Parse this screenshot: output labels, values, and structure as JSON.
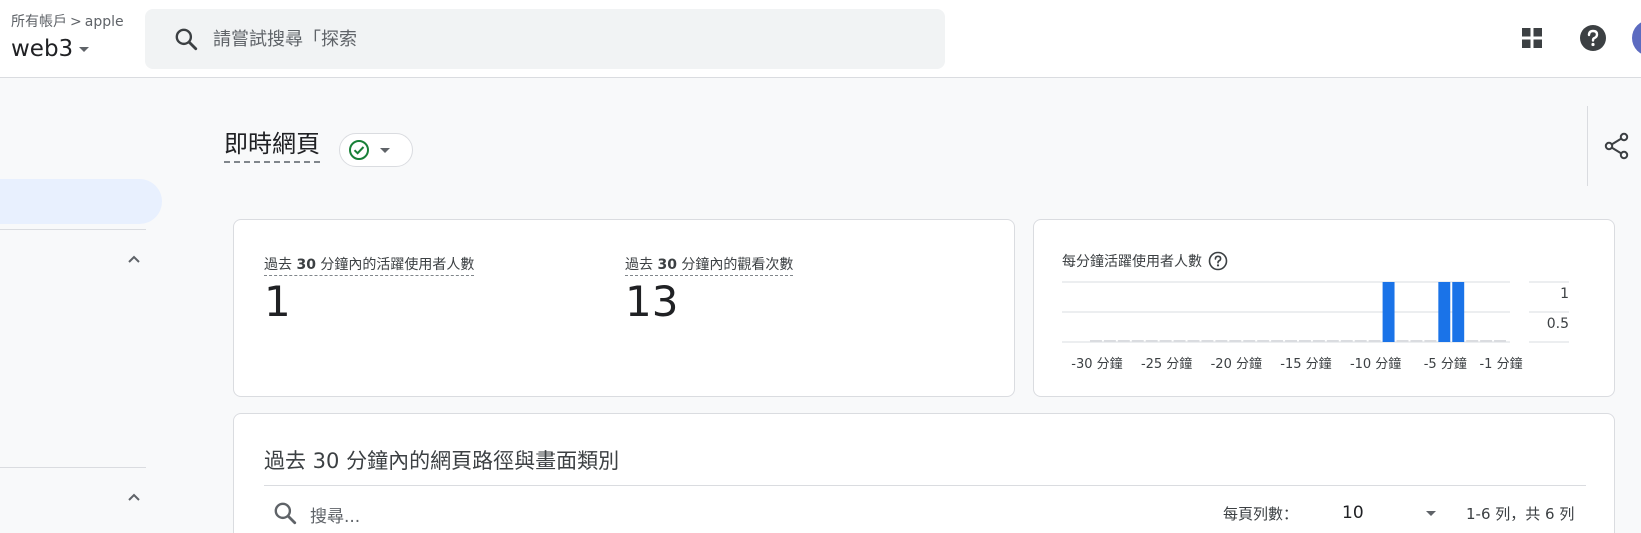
{
  "header": {
    "breadcrumb_root": "所有帳戶",
    "breadcrumb_sep": ">",
    "breadcrumb_account": "apple",
    "property_name": "web3",
    "search_placeholder": "請嘗試搜尋「探索"
  },
  "page": {
    "title": "即時網頁"
  },
  "metrics": [
    {
      "label_prefix": "過去",
      "label_number": "30",
      "label_suffix": "分鐘內的活躍使用者人數",
      "value": "1"
    },
    {
      "label_prefix": "過去",
      "label_number": "30",
      "label_suffix": "分鐘內的觀看次數",
      "value": "13"
    }
  ],
  "chart_title": "每分鐘活躍使用者人數",
  "chart_data": {
    "type": "bar",
    "x": [
      -30,
      -29,
      -28,
      -27,
      -26,
      -25,
      -24,
      -23,
      -22,
      -21,
      -20,
      -19,
      -18,
      -17,
      -16,
      -15,
      -14,
      -13,
      -12,
      -11,
      -10,
      -9,
      -8,
      -7,
      -6,
      -5,
      -4,
      -3,
      -2,
      -1
    ],
    "values": [
      0,
      0,
      0,
      0,
      0,
      0,
      0,
      0,
      0,
      0,
      0,
      0,
      0,
      0,
      0,
      0,
      0,
      0,
      0,
      0,
      0,
      1,
      0,
      0,
      0,
      1,
      1,
      0,
      0,
      0
    ],
    "tick_labels": [
      "-30 分鐘",
      "-25 分鐘",
      "-20 分鐘",
      "-15 分鐘",
      "-10 分鐘",
      "-5 分鐘",
      "-1 分鐘"
    ],
    "tick_values": [
      -30,
      -25,
      -20,
      -15,
      -10,
      -5,
      -1
    ],
    "y_ticks": [
      "1",
      "0.5"
    ],
    "ylim": [
      0,
      1
    ],
    "bar_color": "#1a73e8",
    "zero_color": "#dadce0"
  },
  "table": {
    "title": "過去 30 分鐘內的網頁路徑與畫面類別",
    "search_placeholder": "搜尋...",
    "rows_per_page_label": "每頁列數：",
    "rows_per_page_value": "10",
    "row_count": "1-6 列，共 6 列"
  },
  "colors": {
    "accent": "#1a73e8",
    "status_ok": "#188038"
  }
}
